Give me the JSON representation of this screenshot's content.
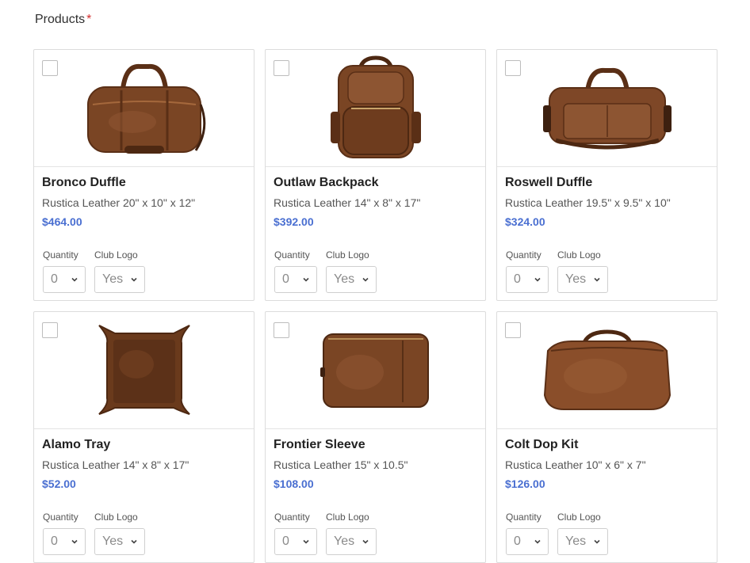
{
  "form": {
    "products_label": "Products",
    "required_mark": "*"
  },
  "products": [
    {
      "name": "Bronco Duffle",
      "desc": "Rustica Leather 20\" x 10\" x 12\"",
      "price": "$464.00",
      "qty_label": "Quantity",
      "qty_value": "0",
      "logo_label": "Club Logo",
      "logo_value": "Yes",
      "image": "duffle-bag"
    },
    {
      "name": "Outlaw Backpack",
      "desc": "Rustica Leather 14\" x 8\" x 17\"",
      "price": "$392.00",
      "qty_label": "Quantity",
      "qty_value": "0",
      "logo_label": "Club Logo",
      "logo_value": "Yes",
      "image": "backpack"
    },
    {
      "name": "Roswell Duffle",
      "desc": "Rustica Leather 19.5\" x 9.5\" x 10\"",
      "price": "$324.00",
      "qty_label": "Quantity",
      "qty_value": "0",
      "logo_label": "Club Logo",
      "logo_value": "Yes",
      "image": "duffle-bag"
    },
    {
      "name": "Alamo Tray",
      "desc": "Rustica Leather 14\" x 8\" x 17\"",
      "price": "$52.00",
      "qty_label": "Quantity",
      "qty_value": "0",
      "logo_label": "Club Logo",
      "logo_value": "Yes",
      "image": "valet-tray"
    },
    {
      "name": "Frontier Sleeve",
      "desc": "Rustica Leather 15\" x 10.5\"",
      "price": "$108.00",
      "qty_label": "Quantity",
      "qty_value": "0",
      "logo_label": "Club Logo",
      "logo_value": "Yes",
      "image": "laptop-sleeve"
    },
    {
      "name": "Colt Dop Kit",
      "desc": "Rustica Leather 10\" x 6\" x 7\"",
      "price": "$126.00",
      "qty_label": "Quantity",
      "qty_value": "0",
      "logo_label": "Club Logo",
      "logo_value": "Yes",
      "image": "dopp-kit"
    }
  ],
  "colors": {
    "price": "#4a6fd1",
    "required": "#d32f2f",
    "leather": "#7a4524"
  }
}
